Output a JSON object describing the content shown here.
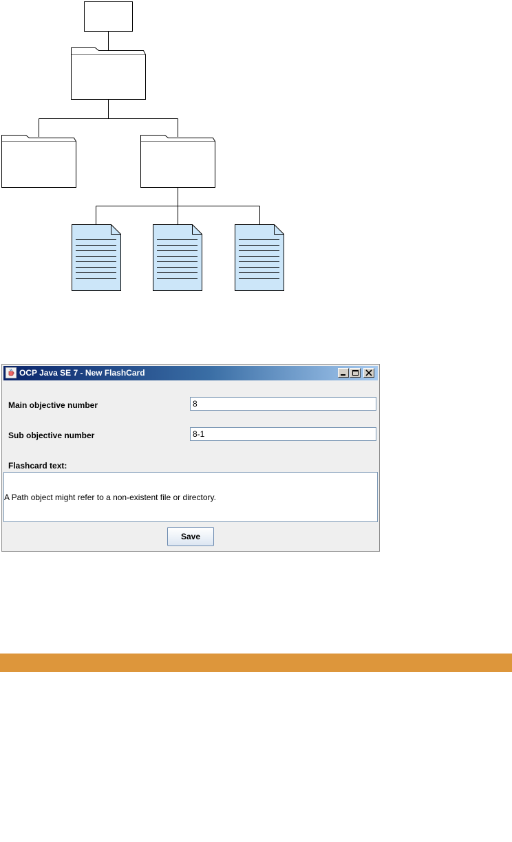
{
  "window": {
    "title": "OCP Java SE 7 - New FlashCard",
    "controls": [
      "minimize",
      "maximize",
      "close"
    ]
  },
  "form": {
    "main_objective_label": "Main objective number",
    "main_objective_value": "8",
    "sub_objective_label": "Sub objective number",
    "sub_objective_value": "8-1",
    "flashcard_label": "Flashcard text:",
    "flashcard_text": "A Path object might refer to a non-existent file or directory.",
    "save_label": "Save"
  },
  "colors": {
    "document_fill": "#cce6f9",
    "banner": "#dd963b"
  }
}
